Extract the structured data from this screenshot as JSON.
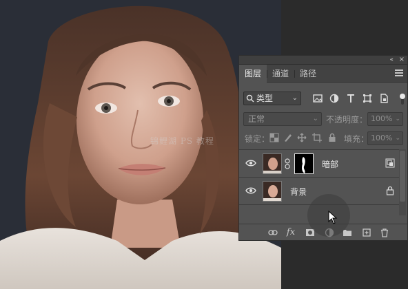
{
  "canvas": {
    "watermark": "锦鲤湖 PS 教程"
  },
  "panel": {
    "collapse_label": "«",
    "close_label": "×",
    "tabs": [
      {
        "label": "图层",
        "active": true
      },
      {
        "label": "通道",
        "active": false
      },
      {
        "label": "路径",
        "active": false
      }
    ],
    "filter": {
      "kind_label": "类型",
      "filter_icons": [
        "image-filter-icon",
        "adjustment-filter-icon",
        "type-filter-icon",
        "shape-filter-icon",
        "smart-object-filter-icon"
      ]
    },
    "blend_mode": "正常",
    "opacity_label": "不透明度：",
    "opacity_value": "100%",
    "lock_label": "锁定：",
    "fill_label": "填充：",
    "fill_value": "100%",
    "layers": [
      {
        "name": "暗部",
        "visible": true,
        "has_mask": true,
        "right_icon": "smart-object-icon"
      },
      {
        "name": "背景",
        "visible": true,
        "has_mask": false,
        "right_icon": "lock-icon"
      }
    ],
    "bottom_buttons": [
      "link-icon",
      "fx-icon",
      "mask-icon",
      "adjustment-icon",
      "folder-icon",
      "new-layer-icon",
      "trash-icon"
    ],
    "fx_label": "fx"
  },
  "colors": {
    "panel_bg": "#535353",
    "tab_bar_bg": "#424242",
    "canvas_bg": "#2a2e37"
  }
}
